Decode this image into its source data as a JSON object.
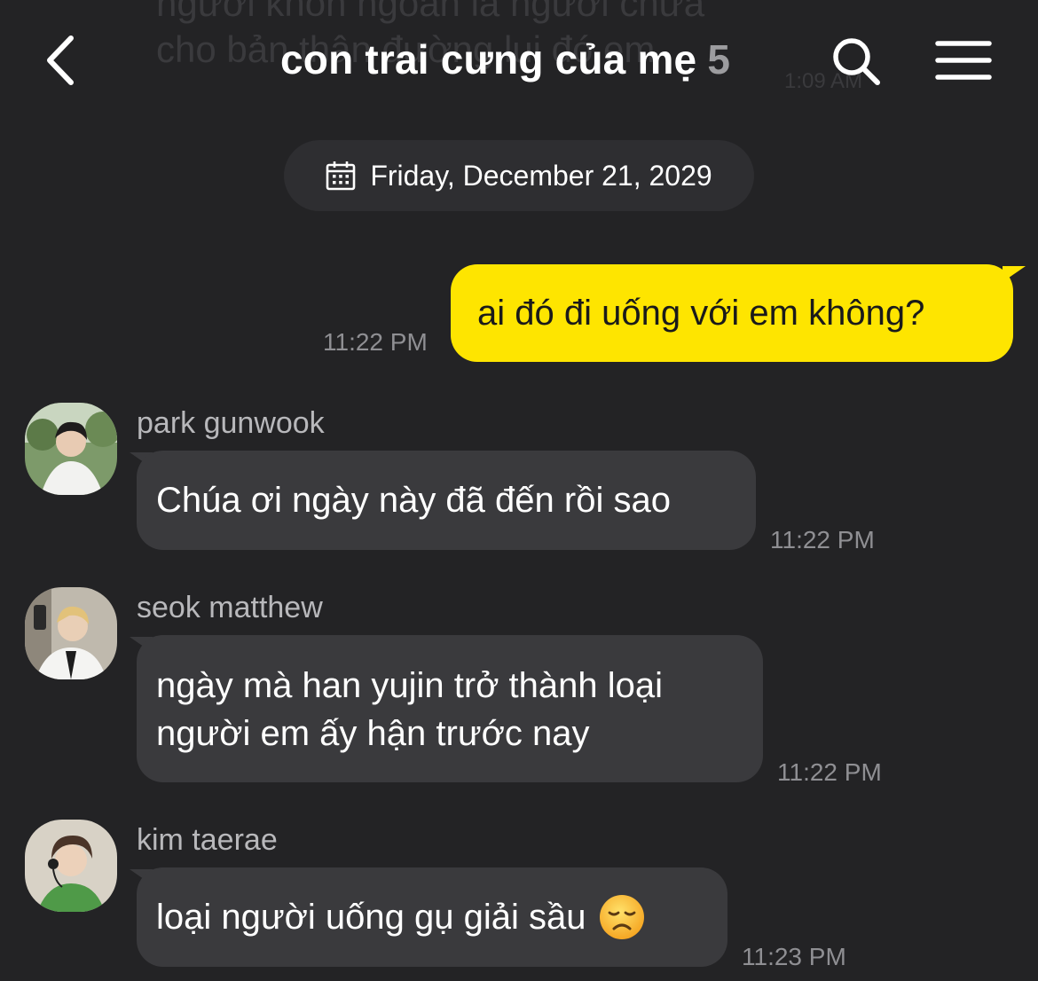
{
  "background_ghost": {
    "text": "người khôn ngoan là người chưa cho bản thân đường lui đó em",
    "time": "1:09 AM"
  },
  "header": {
    "back_icon": "chevron-left-icon",
    "title": "con trai cưng của mẹ",
    "member_count": "5",
    "search_icon": "search-icon",
    "menu_icon": "hamburger-menu-icon"
  },
  "date_divider": {
    "icon": "calendar-icon",
    "label": "Friday, December 21, 2029"
  },
  "messages": [
    {
      "from_me": true,
      "text": "ai đó đi uống với em không?",
      "time": "11:22 PM"
    },
    {
      "from_me": false,
      "sender": "park gunwook",
      "text": "Chúa ơi ngày này đã đến rồi sao",
      "time": "11:22 PM"
    },
    {
      "from_me": false,
      "sender": "seok matthew",
      "lines": [
        "ngày mà han yujin trở thành loại",
        "người em ấy hận trước nay"
      ],
      "time": "11:22 PM"
    },
    {
      "from_me": false,
      "sender": "kim taerae",
      "text": "loại người uống gụ giải sầu",
      "emoji": "😞",
      "time": "11:23 PM"
    }
  ],
  "colors": {
    "background": "#232325",
    "my_bubble": "#fee500",
    "other_bubble": "#3a3a3d",
    "date_pill": "#2e2e31",
    "timestamp": "#8f8f93",
    "sender_name": "#b8b8bb"
  }
}
